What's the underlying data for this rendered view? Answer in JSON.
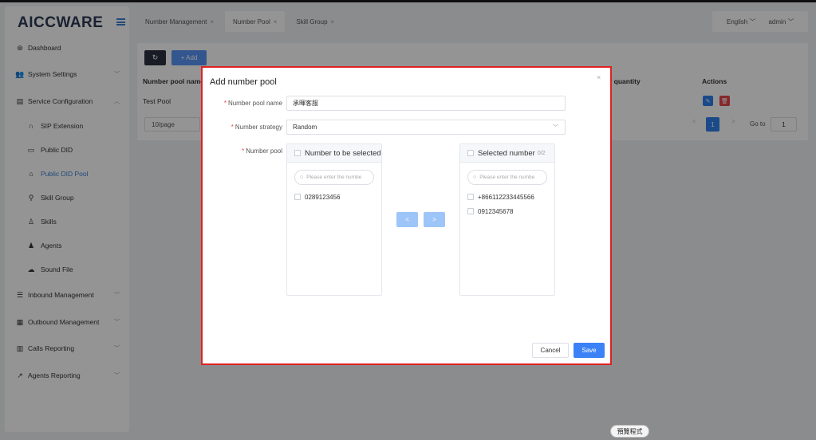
{
  "app": {
    "logo": "AICCWARE"
  },
  "sidebar": {
    "items": [
      {
        "label": "Dashboard",
        "icon": "dashboard-icon"
      },
      {
        "label": "System Settings",
        "icon": "users-icon",
        "expandable": true
      },
      {
        "label": "Service Configuration",
        "icon": "id-card-icon",
        "expandable": true,
        "expanded": true
      },
      {
        "label": "SIP Extension",
        "icon": "headset-icon",
        "sub": true
      },
      {
        "label": "Public DID",
        "icon": "folder-icon",
        "sub": true
      },
      {
        "label": "Public DID Pool",
        "icon": "home-icon",
        "sub": true,
        "active": true
      },
      {
        "label": "Skill Group",
        "icon": "group-icon",
        "sub": true
      },
      {
        "label": "Skills",
        "icon": "person-outline-icon",
        "sub": true
      },
      {
        "label": "Agents",
        "icon": "person-icon",
        "sub": true
      },
      {
        "label": "Sound File",
        "icon": "cloud-icon",
        "sub": true
      },
      {
        "label": "Inbound Management",
        "icon": "list-icon",
        "expandable": true
      },
      {
        "label": "Outbound Management",
        "icon": "table-icon",
        "expandable": true
      },
      {
        "label": "Calls Reporting",
        "icon": "bar-chart-icon",
        "expandable": true
      },
      {
        "label": "Agents Reporting",
        "icon": "line-chart-icon",
        "expandable": true
      }
    ]
  },
  "tabs": [
    {
      "label": "Number Management",
      "active": false
    },
    {
      "label": "Number Pool",
      "active": true
    },
    {
      "label": "Skill Group",
      "active": false
    }
  ],
  "header": {
    "language": "English",
    "user": "admin"
  },
  "toolbar": {
    "add_label": "+ Add",
    "refresh_icon": "refresh-icon"
  },
  "table": {
    "columns": {
      "name": "Number pool name",
      "quantity": "r quantity",
      "actions": "Actions"
    },
    "rows": [
      {
        "name": "Test Pool"
      }
    ]
  },
  "pagination": {
    "page_size": "10/page",
    "prev": "<",
    "current_page": "1",
    "next": ">",
    "goto_label": "Go to",
    "goto_value": "1"
  },
  "modal": {
    "title": "Add number pool",
    "close": "×",
    "fields": {
      "pool_name": {
        "label": "Number pool name",
        "value": "承暉客服"
      },
      "strategy": {
        "label": "Number strategy",
        "value": "Random"
      },
      "pool": {
        "label": "Number pool"
      }
    },
    "source_panel": {
      "title": "Number to be selected",
      "search_placeholder": "Please enter the numbe",
      "items": [
        "0289123456"
      ]
    },
    "target_panel": {
      "title": "Selected number",
      "count": "0/2",
      "search_placeholder": "Please enter the numbe",
      "items": [
        "+866112233445566",
        "0912345678"
      ]
    },
    "transfer": {
      "left": "<",
      "right": ">"
    },
    "cancel_label": "Cancel",
    "save_label": "Save"
  },
  "tooltip": "預覽程式",
  "colors": {
    "primary": "#3b82f6",
    "danger": "#e5484d",
    "highlight_border": "#e02020",
    "dark_button": "#2b3140"
  }
}
